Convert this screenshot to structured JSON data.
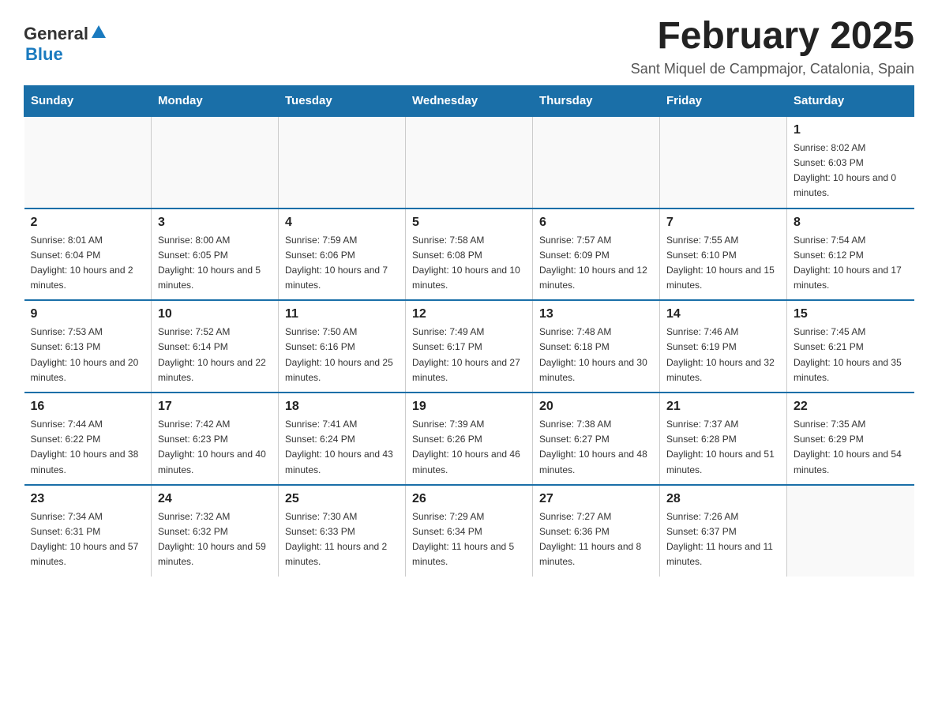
{
  "header": {
    "logo_general": "General",
    "logo_blue": "Blue",
    "main_title": "February 2025",
    "subtitle": "Sant Miquel de Campmajor, Catalonia, Spain"
  },
  "calendar": {
    "days_of_week": [
      "Sunday",
      "Monday",
      "Tuesday",
      "Wednesday",
      "Thursday",
      "Friday",
      "Saturday"
    ],
    "weeks": [
      [
        {
          "day": "",
          "info": ""
        },
        {
          "day": "",
          "info": ""
        },
        {
          "day": "",
          "info": ""
        },
        {
          "day": "",
          "info": ""
        },
        {
          "day": "",
          "info": ""
        },
        {
          "day": "",
          "info": ""
        },
        {
          "day": "1",
          "info": "Sunrise: 8:02 AM\nSunset: 6:03 PM\nDaylight: 10 hours and 0 minutes."
        }
      ],
      [
        {
          "day": "2",
          "info": "Sunrise: 8:01 AM\nSunset: 6:04 PM\nDaylight: 10 hours and 2 minutes."
        },
        {
          "day": "3",
          "info": "Sunrise: 8:00 AM\nSunset: 6:05 PM\nDaylight: 10 hours and 5 minutes."
        },
        {
          "day": "4",
          "info": "Sunrise: 7:59 AM\nSunset: 6:06 PM\nDaylight: 10 hours and 7 minutes."
        },
        {
          "day": "5",
          "info": "Sunrise: 7:58 AM\nSunset: 6:08 PM\nDaylight: 10 hours and 10 minutes."
        },
        {
          "day": "6",
          "info": "Sunrise: 7:57 AM\nSunset: 6:09 PM\nDaylight: 10 hours and 12 minutes."
        },
        {
          "day": "7",
          "info": "Sunrise: 7:55 AM\nSunset: 6:10 PM\nDaylight: 10 hours and 15 minutes."
        },
        {
          "day": "8",
          "info": "Sunrise: 7:54 AM\nSunset: 6:12 PM\nDaylight: 10 hours and 17 minutes."
        }
      ],
      [
        {
          "day": "9",
          "info": "Sunrise: 7:53 AM\nSunset: 6:13 PM\nDaylight: 10 hours and 20 minutes."
        },
        {
          "day": "10",
          "info": "Sunrise: 7:52 AM\nSunset: 6:14 PM\nDaylight: 10 hours and 22 minutes."
        },
        {
          "day": "11",
          "info": "Sunrise: 7:50 AM\nSunset: 6:16 PM\nDaylight: 10 hours and 25 minutes."
        },
        {
          "day": "12",
          "info": "Sunrise: 7:49 AM\nSunset: 6:17 PM\nDaylight: 10 hours and 27 minutes."
        },
        {
          "day": "13",
          "info": "Sunrise: 7:48 AM\nSunset: 6:18 PM\nDaylight: 10 hours and 30 minutes."
        },
        {
          "day": "14",
          "info": "Sunrise: 7:46 AM\nSunset: 6:19 PM\nDaylight: 10 hours and 32 minutes."
        },
        {
          "day": "15",
          "info": "Sunrise: 7:45 AM\nSunset: 6:21 PM\nDaylight: 10 hours and 35 minutes."
        }
      ],
      [
        {
          "day": "16",
          "info": "Sunrise: 7:44 AM\nSunset: 6:22 PM\nDaylight: 10 hours and 38 minutes."
        },
        {
          "day": "17",
          "info": "Sunrise: 7:42 AM\nSunset: 6:23 PM\nDaylight: 10 hours and 40 minutes."
        },
        {
          "day": "18",
          "info": "Sunrise: 7:41 AM\nSunset: 6:24 PM\nDaylight: 10 hours and 43 minutes."
        },
        {
          "day": "19",
          "info": "Sunrise: 7:39 AM\nSunset: 6:26 PM\nDaylight: 10 hours and 46 minutes."
        },
        {
          "day": "20",
          "info": "Sunrise: 7:38 AM\nSunset: 6:27 PM\nDaylight: 10 hours and 48 minutes."
        },
        {
          "day": "21",
          "info": "Sunrise: 7:37 AM\nSunset: 6:28 PM\nDaylight: 10 hours and 51 minutes."
        },
        {
          "day": "22",
          "info": "Sunrise: 7:35 AM\nSunset: 6:29 PM\nDaylight: 10 hours and 54 minutes."
        }
      ],
      [
        {
          "day": "23",
          "info": "Sunrise: 7:34 AM\nSunset: 6:31 PM\nDaylight: 10 hours and 57 minutes."
        },
        {
          "day": "24",
          "info": "Sunrise: 7:32 AM\nSunset: 6:32 PM\nDaylight: 10 hours and 59 minutes."
        },
        {
          "day": "25",
          "info": "Sunrise: 7:30 AM\nSunset: 6:33 PM\nDaylight: 11 hours and 2 minutes."
        },
        {
          "day": "26",
          "info": "Sunrise: 7:29 AM\nSunset: 6:34 PM\nDaylight: 11 hours and 5 minutes."
        },
        {
          "day": "27",
          "info": "Sunrise: 7:27 AM\nSunset: 6:36 PM\nDaylight: 11 hours and 8 minutes."
        },
        {
          "day": "28",
          "info": "Sunrise: 7:26 AM\nSunset: 6:37 PM\nDaylight: 11 hours and 11 minutes."
        },
        {
          "day": "",
          "info": ""
        }
      ]
    ]
  }
}
